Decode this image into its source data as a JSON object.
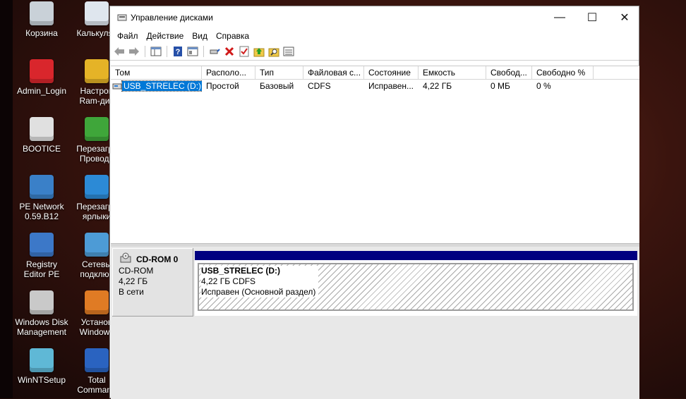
{
  "desktop": {
    "icons": [
      {
        "label": "Корзина",
        "name": "desktop-icon-recycle-bin",
        "icon": "recycle-bin-icon",
        "color": "#c9d1d8"
      },
      {
        "label": "Калькулят",
        "name": "desktop-icon-calculator",
        "icon": "calculator-icon",
        "color": "#dfe6ee"
      },
      {
        "label": "Admin_Login",
        "name": "desktop-icon-admin-login",
        "icon": "admin-login-icon",
        "color": "#d9262c"
      },
      {
        "label": "Настрой\nRam-дис",
        "name": "desktop-icon-ram-disk",
        "icon": "ram-disk-icon",
        "color": "#e5b327"
      },
      {
        "label": "BOOTICE",
        "name": "desktop-icon-bootice",
        "icon": "bootice-icon",
        "color": "#e0e0e0"
      },
      {
        "label": "Перезагру\nПроводн",
        "name": "desktop-icon-restart-explorer",
        "icon": "restart-icon",
        "color": "#3fa63a"
      },
      {
        "label": "PE Network\n0.59.B12",
        "name": "desktop-icon-pe-network",
        "icon": "network-monitor-icon",
        "color": "#3a80c8"
      },
      {
        "label": "Перезагру\nярлыки",
        "name": "desktop-icon-restart-shortcuts",
        "icon": "m-logo-icon",
        "color": "#2c8ad6"
      },
      {
        "label": "Registry\nEditor PE",
        "name": "desktop-icon-registry-editor",
        "icon": "registry-icon",
        "color": "#3c78c8"
      },
      {
        "label": "Сетевы\nподключ",
        "name": "desktop-icon-network-connections",
        "icon": "globe-icon",
        "color": "#4d9bd6"
      },
      {
        "label": "Windows Disk\nManagement",
        "name": "desktop-icon-disk-management",
        "icon": "disk-management-icon",
        "color": "#c9c9c9"
      },
      {
        "label": "Установ\nWindows",
        "name": "desktop-icon-windows-install",
        "icon": "windows-install-icon",
        "color": "#e07b24"
      },
      {
        "label": "WinNTSetup",
        "name": "desktop-icon-winntsetup",
        "icon": "winntsetup-icon",
        "color": "#5fb8d6"
      },
      {
        "label": "Total\nCommand",
        "name": "desktop-icon-total-commander",
        "icon": "total-commander-icon",
        "color": "#2a63c0"
      }
    ]
  },
  "window": {
    "title": "Управление дисками",
    "buttons": {
      "minimize": "—",
      "maximize": "☐",
      "close": "✕"
    }
  },
  "menu": [
    "Файл",
    "Действие",
    "Вид",
    "Справка"
  ],
  "volume_table": {
    "columns": [
      "Том",
      "Располо...",
      "Тип",
      "Файловая с...",
      "Состояние",
      "Емкость",
      "Свобод...",
      "Свободно %"
    ],
    "rows": [
      [
        "USB_STRELEC (D:)",
        "Простой",
        "Базовый",
        "CDFS",
        "Исправен...",
        "4,22 ГБ",
        "0 МБ",
        "0 %"
      ]
    ]
  },
  "disk": {
    "name": "CD-ROM 0",
    "type": "CD-ROM",
    "size": "4,22 ГБ",
    "status": "В сети",
    "partition": {
      "name": "USB_STRELEC  (D:)",
      "size_fs": "4,22 ГБ CDFS",
      "status": "Исправен (Основной раздел)"
    }
  },
  "colors": {
    "selection": "#0078d7",
    "partition_bar": "#000080"
  }
}
